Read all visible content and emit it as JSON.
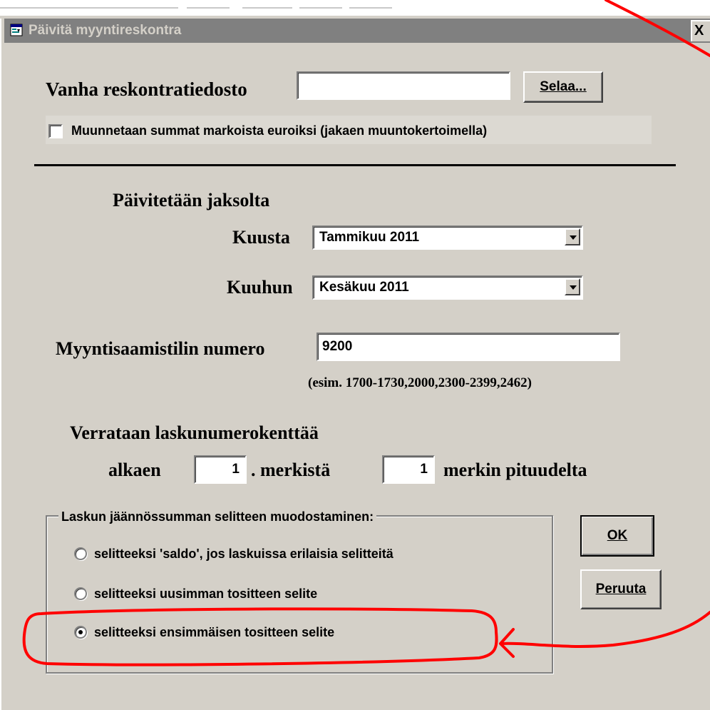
{
  "window": {
    "title": "Päivitä myyntireskontra",
    "close_glyph": "X",
    "icon": "app-window-icon"
  },
  "old_file": {
    "label": "Vanha reskontratiedosto",
    "value": "",
    "browse_label": "Selaa..."
  },
  "convert_checkbox": {
    "label": "Muunnetaan summat markoista euroiksi (jakaen muuntokertoimella)",
    "checked": false
  },
  "period": {
    "heading": "Päivitetään jaksolta",
    "from_label": "Kuusta",
    "from_value": "Tammikuu 2011",
    "to_label": "Kuuhun",
    "to_value": "Kesäkuu 2011"
  },
  "account": {
    "label": "Myyntisaamistilin numero",
    "value": "9200",
    "hint": "(esim. 1700-1730,2000,2300-2399,2462)"
  },
  "compare": {
    "heading": "Verrataan laskunumerokenttää",
    "start_label": "alkaen",
    "start_value": "1",
    "start_suffix": ". merkistä",
    "length_value": "1",
    "length_suffix": "merkin pituudelta"
  },
  "explanation_group": {
    "legend": "Laskun jäännössumman selitteen muodostaminen:",
    "options": [
      {
        "label": "selitteeksi 'saldo', jos laskuissa erilaisia selitteitä",
        "selected": false
      },
      {
        "label": "selitteeksi uusimman tositteen selite",
        "selected": false
      },
      {
        "label": "selitteeksi ensimmäisen tositteen selite",
        "selected": true
      }
    ]
  },
  "buttons": {
    "ok_label": "OK",
    "cancel_label": "Peruuta"
  },
  "annotation": {
    "color": "#ff0000"
  }
}
